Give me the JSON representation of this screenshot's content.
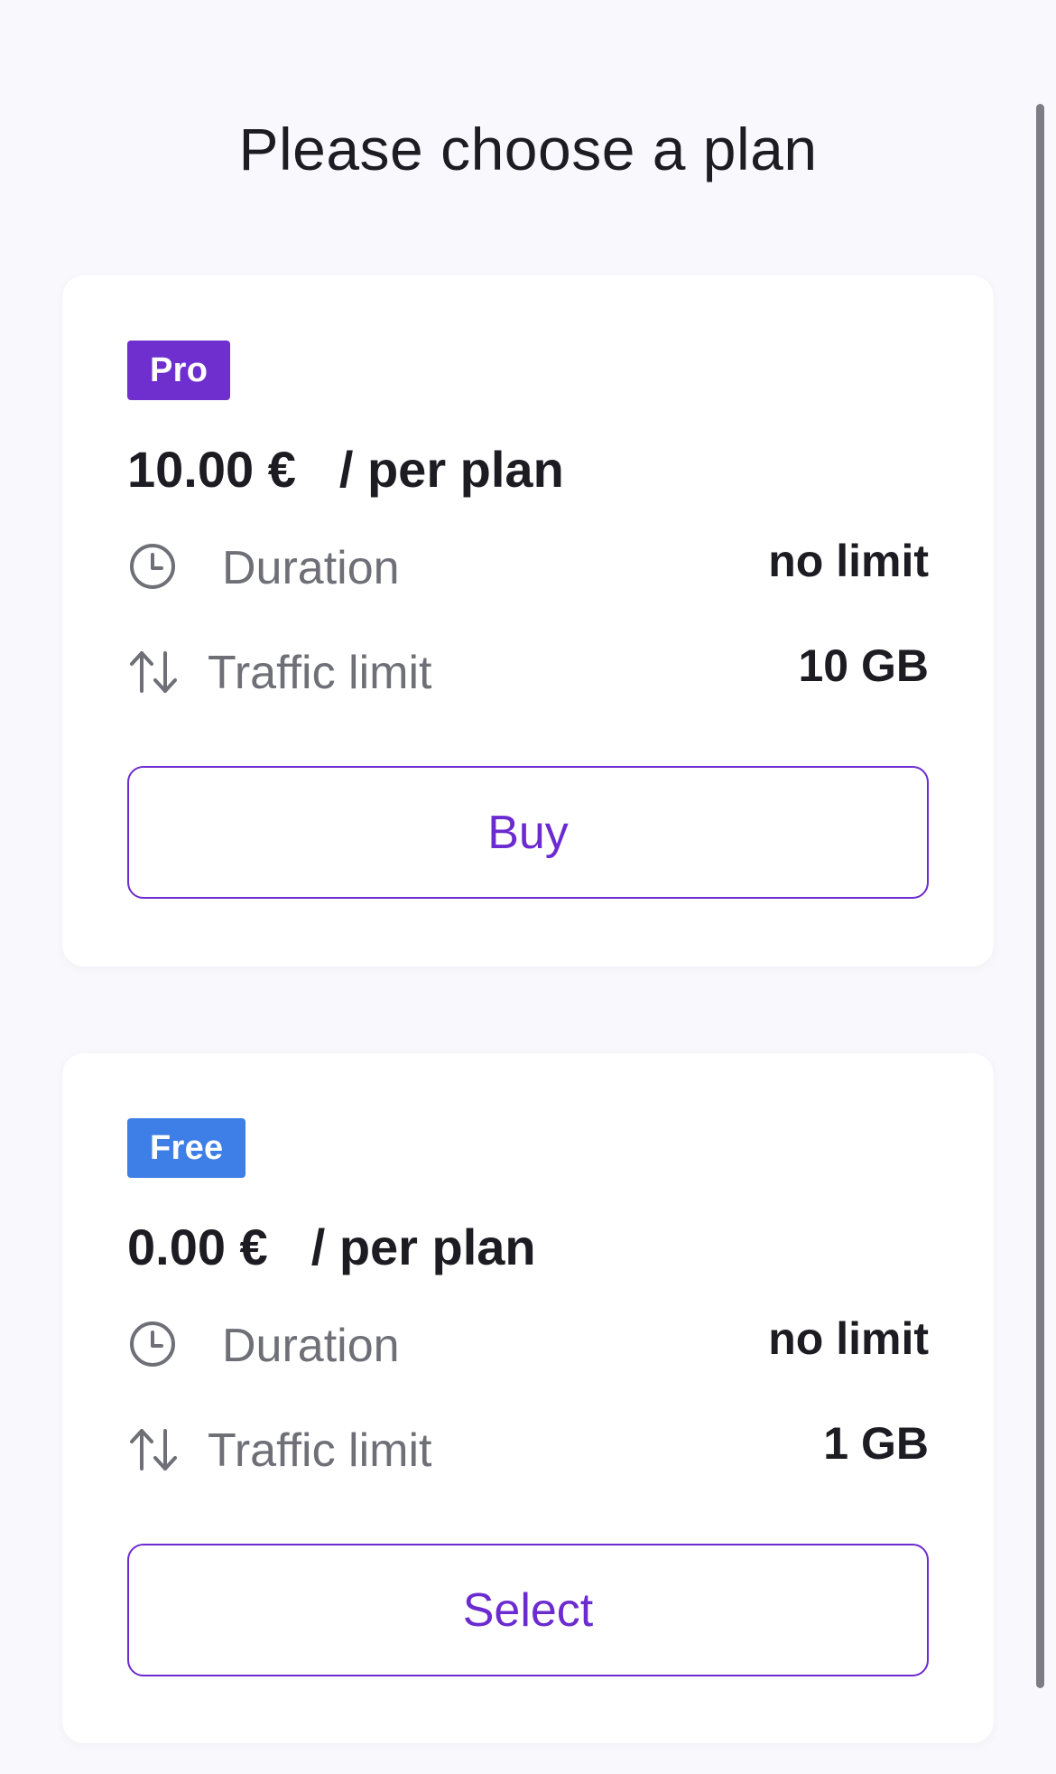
{
  "page": {
    "title": "Please choose a plan"
  },
  "plans": [
    {
      "badge": "Pro",
      "badge_color": "#6f2fcf",
      "price": "10.00 €",
      "per_label": "/ per plan",
      "duration_icon": "clock-icon",
      "duration_label": "Duration",
      "duration_value": "no limit",
      "traffic_icon": "up-down-arrows-icon",
      "traffic_label": "Traffic limit",
      "traffic_value": "10 GB",
      "button_label": "Buy"
    },
    {
      "badge": "Free",
      "badge_color": "#3e7fe7",
      "price": "0.00 €",
      "per_label": "/ per plan",
      "duration_icon": "clock-icon",
      "duration_label": "Duration",
      "duration_value": "no limit",
      "traffic_icon": "up-down-arrows-icon",
      "traffic_label": "Traffic limit",
      "traffic_value": "1 GB",
      "button_label": "Select"
    }
  ],
  "colors": {
    "accent": "#6c2bd0",
    "background": "#f8f8fd",
    "card": "#ffffff",
    "muted_text": "#6f6f78"
  }
}
